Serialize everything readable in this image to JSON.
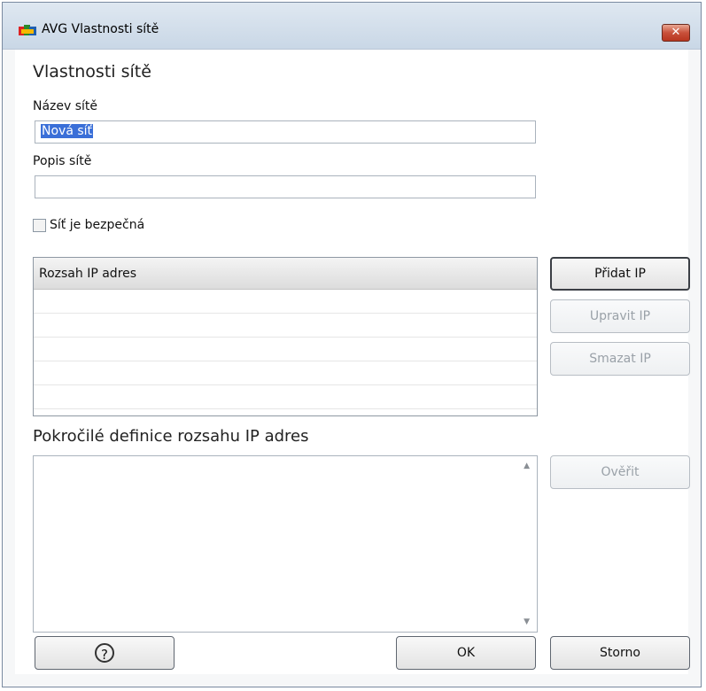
{
  "window": {
    "title": "AVG Vlastnosti sítě",
    "close_icon": "close-icon"
  },
  "heading": "Vlastnosti sítě",
  "network_name": {
    "label": "Název sítě",
    "value": "Nová síť"
  },
  "network_desc": {
    "label": "Popis sítě",
    "value": ""
  },
  "secure_checkbox": {
    "label": "Síť je bezpečná",
    "checked": false
  },
  "ip_list": {
    "column_header": "Rozsah IP adres",
    "rows": []
  },
  "ip_buttons": {
    "add": "Přidat IP",
    "edit": "Upravit IP",
    "delete": "Smazat IP"
  },
  "advanced": {
    "title": "Pokročilé definice rozsahu IP adres",
    "value": "",
    "verify": "Ověřit"
  },
  "footer": {
    "help_icon": "help-icon",
    "ok": "OK",
    "cancel": "Storno"
  },
  "colors": {
    "selection": "#3a6fd8",
    "close_button": "#c9503a"
  }
}
